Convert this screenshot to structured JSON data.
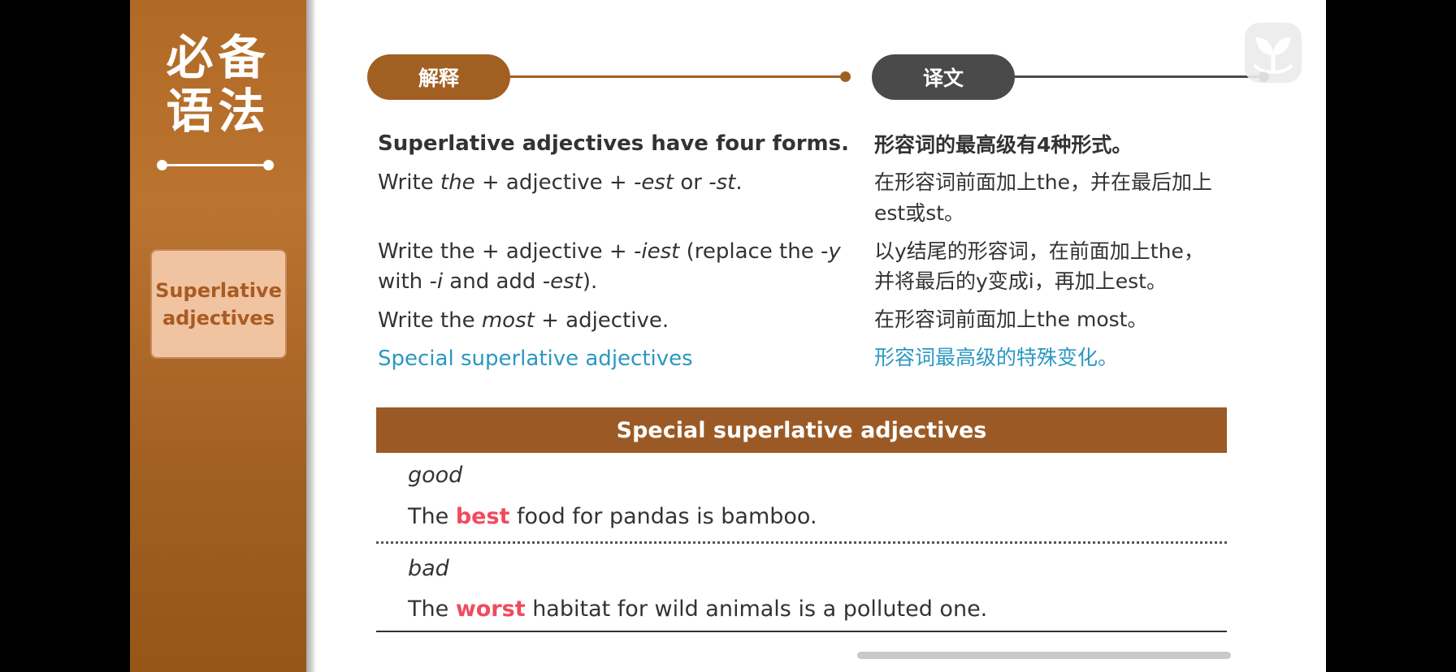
{
  "sidebar": {
    "title_line1": "必备",
    "title_line2": "语法",
    "topic_line1": "Superlative",
    "topic_line2": "adjectives"
  },
  "tabs": {
    "explain_label": "解释",
    "translate_label": "译文"
  },
  "colors": {
    "brown": "#a25f22",
    "dark_gray": "#4a4a4a",
    "link_blue": "#2a98c2",
    "highlight_red": "#f14b5e"
  },
  "explain": {
    "heading": "Superlative adjectives have four forms.",
    "rule1": {
      "a": "Write ",
      "b": "the",
      "c": " + adjective + ",
      "d": "-est",
      "e": " or ",
      "f": "-st",
      "g": "."
    },
    "rule2_line1": {
      "a": "Write the + adjective + ",
      "b": "-iest",
      "c": " (replace the ",
      "d": "-y"
    },
    "rule2_line2": {
      "a": "with ",
      "b": "-i",
      "c": " and add ",
      "d": "-est",
      "e": ")."
    },
    "rule3": {
      "a": "Write the ",
      "b": "most",
      "c": " + adjective."
    },
    "special_link": "Special superlative adjectives"
  },
  "translation": {
    "heading": "形容词的最高级有4种形式。",
    "rule1_line1": "在形容词前面加上the，并在最后加上",
    "rule1_line2": "est或st。",
    "rule2_line1": "以y结尾的形容词，在前面加上the，",
    "rule2_line2": "并将最后的y变成i，再加上est。",
    "rule3": "在形容词前面加上the most。",
    "special_link": "形容词最高级的特殊变化。"
  },
  "table": {
    "header": "Special superlative adjectives",
    "rows": [
      {
        "word": "good",
        "pre": "The ",
        "highlight": "best",
        "post": " food for pandas is bamboo."
      },
      {
        "word": "bad",
        "pre": "The ",
        "highlight": "worst",
        "post": " habitat for wild animals is a polluted one."
      }
    ]
  },
  "icons": {
    "logo": "sprout-logo-icon"
  }
}
